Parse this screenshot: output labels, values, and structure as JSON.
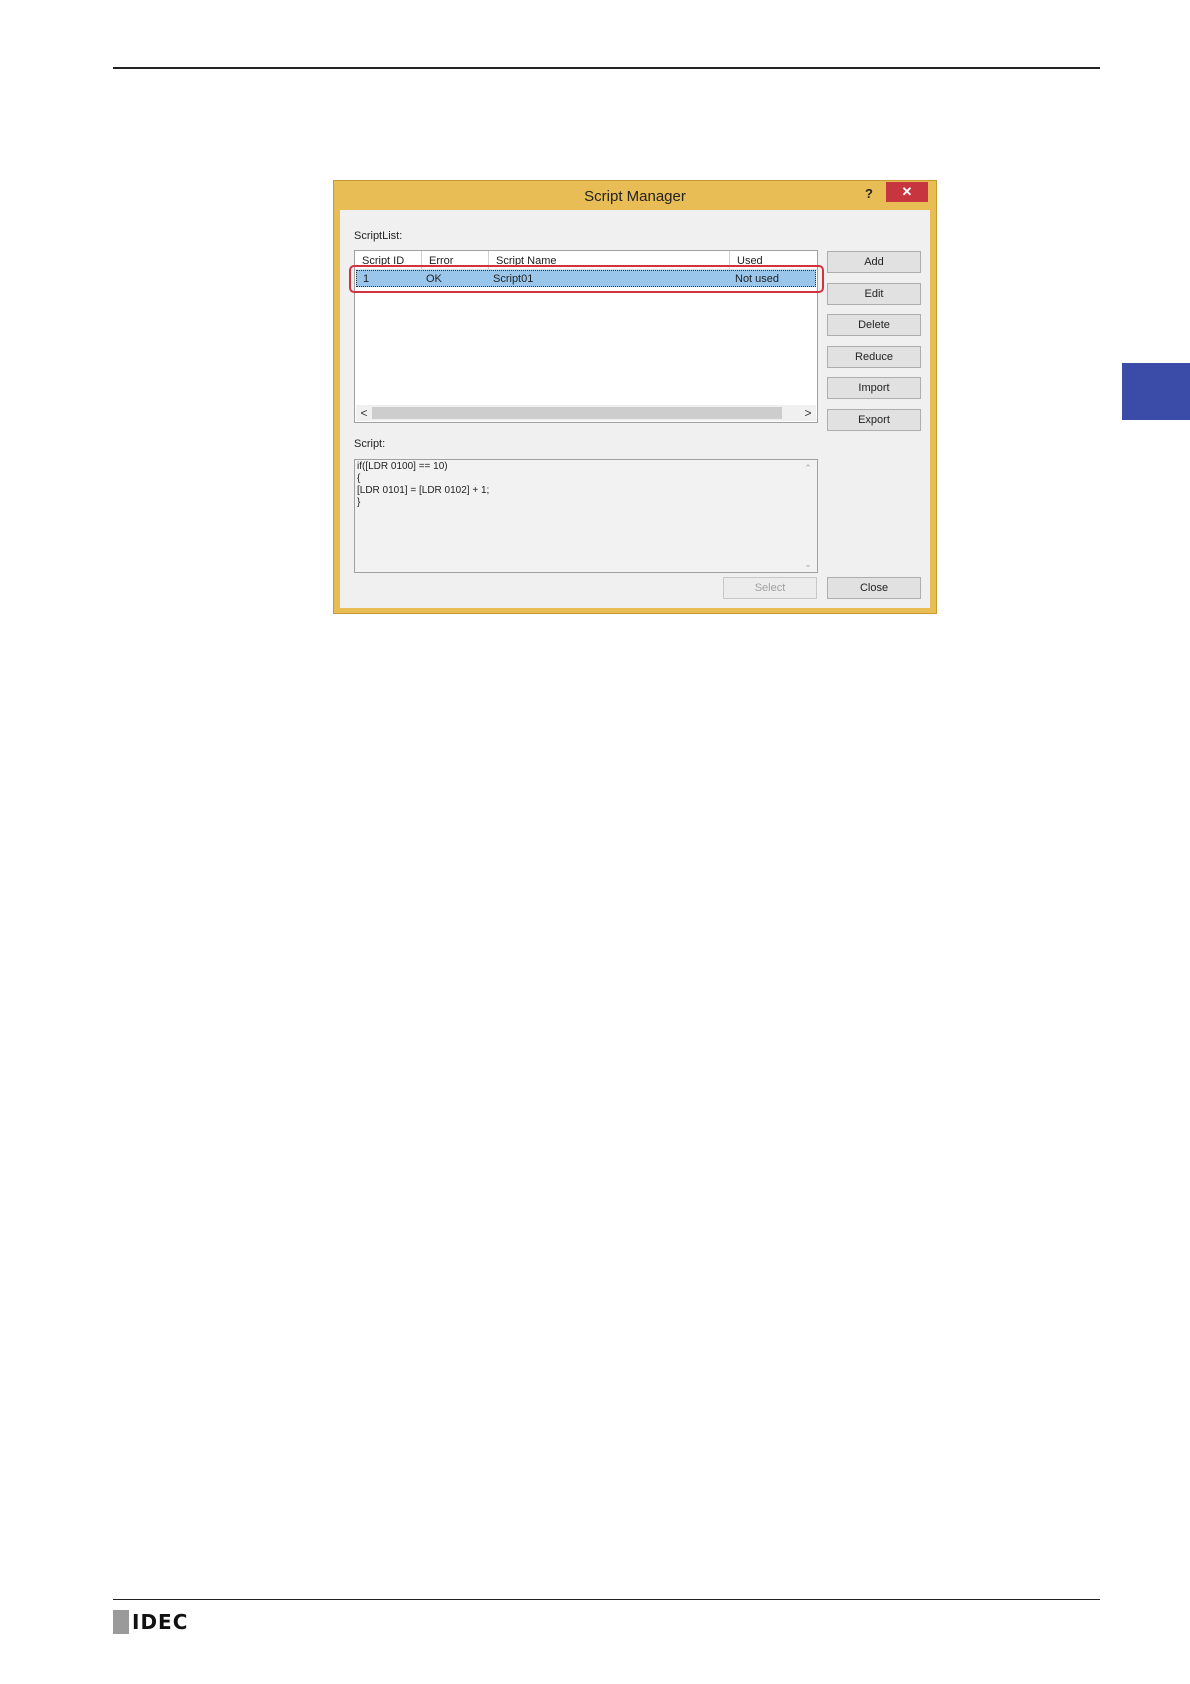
{
  "page": {
    "logo_text": "IDEC"
  },
  "dialog": {
    "title": "Script Manager",
    "help_label": "?",
    "close_label": "✕",
    "script_list_label": "ScriptList:",
    "columns": [
      "Script ID",
      "Error",
      "Script Name",
      "Used"
    ],
    "rows": [
      {
        "id": "1",
        "error": "OK",
        "name": "Script01",
        "used": "Not used"
      }
    ],
    "scroll_left": "<",
    "scroll_right": ">",
    "buttons": {
      "add": "Add",
      "edit": "Edit",
      "delete": "Delete",
      "reduce": "Reduce",
      "import": "Import",
      "export": "Export",
      "select": "Select",
      "close": "Close"
    },
    "script_label": "Script:",
    "script_lines": [
      "if([LDR 0100] == 10)",
      "{",
      "[LDR 0101] = [LDR 0102] + 1;",
      "}"
    ],
    "colors": {
      "frame": "#e8bd55",
      "close": "#c7363e",
      "selection": "#99c6ea",
      "highlight": "#d4323c",
      "side_tab": "#3a4ba8"
    }
  }
}
